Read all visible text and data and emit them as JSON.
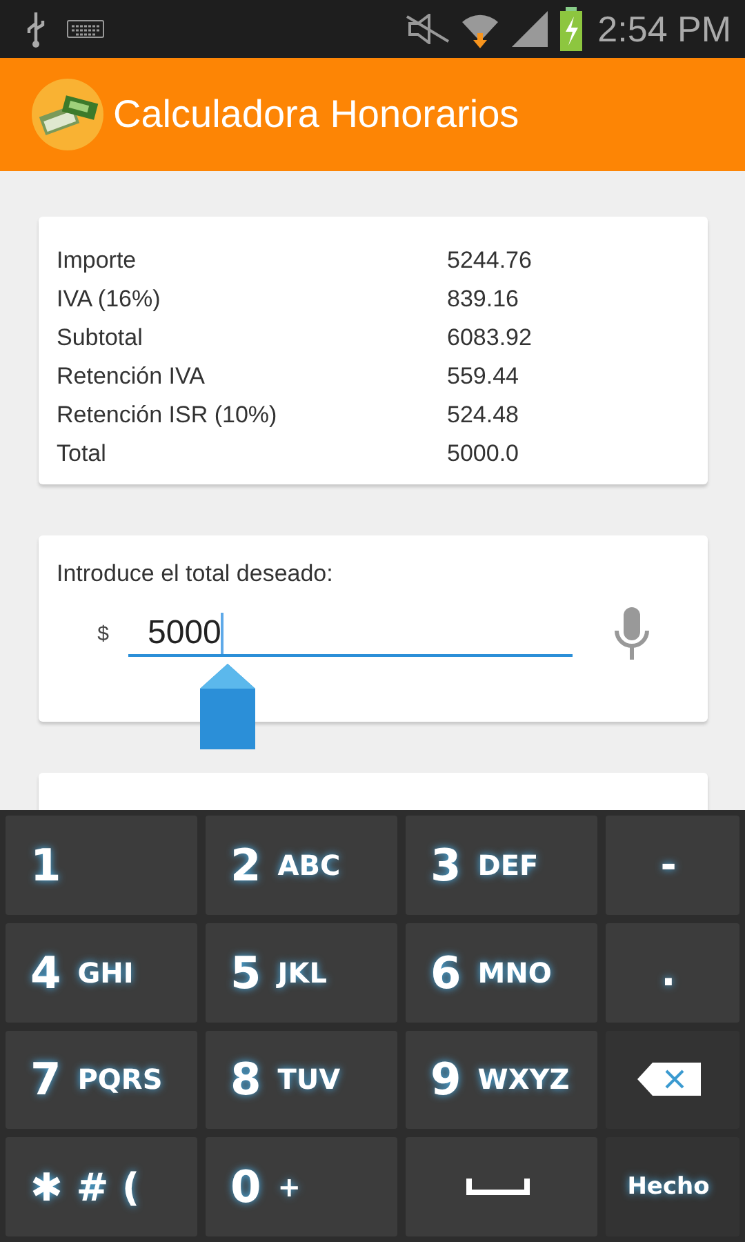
{
  "status_bar": {
    "time": "2:54 PM"
  },
  "app_bar": {
    "title": "Calculadora Honorarios"
  },
  "summary": [
    {
      "label": "Importe",
      "value": "5244.76"
    },
    {
      "label": "IVA (16%)",
      "value": "839.16"
    },
    {
      "label": "Subtotal",
      "value": "6083.92"
    },
    {
      "label": "Retención IVA",
      "value": "559.44"
    },
    {
      "label": "Retención ISR (10%)",
      "value": "524.48"
    },
    {
      "label": "Total",
      "value": "5000.0"
    }
  ],
  "input_card": {
    "prompt": "Introduce el total deseado:",
    "currency": "$",
    "value": "5000"
  },
  "keyboard": [
    {
      "kind": "digit",
      "main": "1"
    },
    {
      "kind": "digit",
      "main": "2",
      "sub": "ABC"
    },
    {
      "kind": "digit",
      "main": "3",
      "sub": "DEF"
    },
    {
      "kind": "symbol",
      "main": "-"
    },
    {
      "kind": "digit",
      "main": "4",
      "sub": "GHI"
    },
    {
      "kind": "digit",
      "main": "5",
      "sub": "JKL"
    },
    {
      "kind": "digit",
      "main": "6",
      "sub": "MNO"
    },
    {
      "kind": "symbol",
      "main": "."
    },
    {
      "kind": "digit",
      "main": "7",
      "sub": "PQRS"
    },
    {
      "kind": "digit",
      "main": "8",
      "sub": "TUV"
    },
    {
      "kind": "digit",
      "main": "9",
      "sub": "WXYZ"
    },
    {
      "kind": "backspace"
    },
    {
      "kind": "symbol",
      "main": "✱ # ("
    },
    {
      "kind": "digit",
      "main": "0",
      "sub": "+"
    },
    {
      "kind": "space"
    },
    {
      "kind": "done",
      "label": "Hecho"
    }
  ]
}
